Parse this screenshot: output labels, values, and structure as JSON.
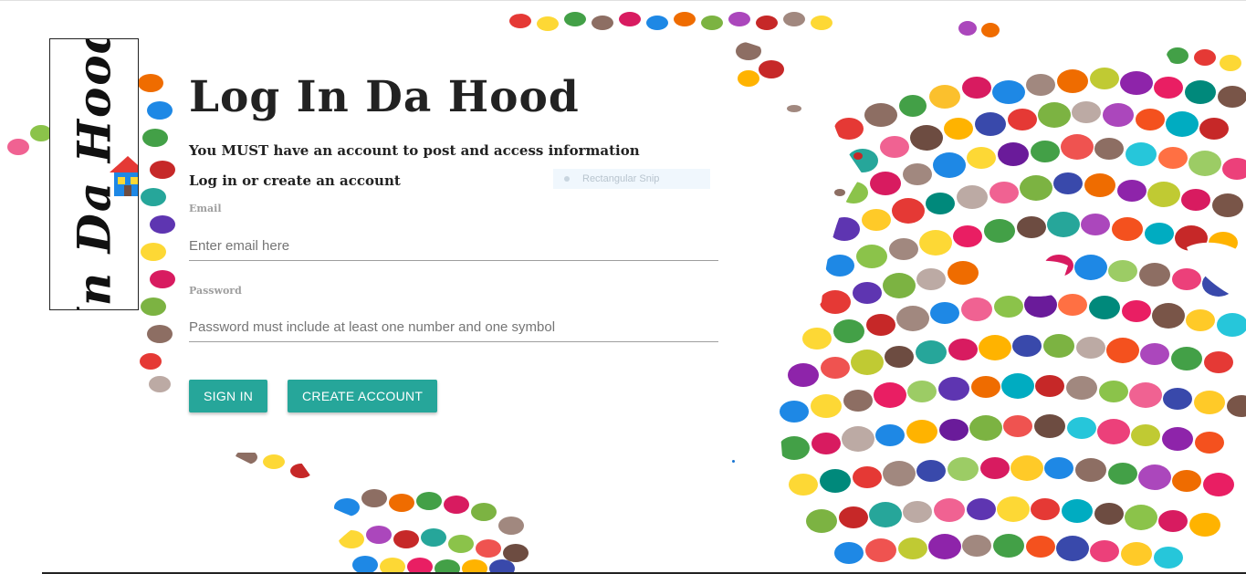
{
  "logo": {
    "text": "In Da Hood",
    "icon": "house-icon"
  },
  "form": {
    "title": "Log In Da Hood",
    "subtitle": "You MUST have an account to post and access information",
    "subtitle2": "Log in or create an account",
    "email_label": "Email",
    "email_placeholder": "Enter email here",
    "email_value": "",
    "password_label": "Password",
    "password_placeholder": "Password must include at least one number and one symbol",
    "password_value": "",
    "signin_label": "SIGN IN",
    "create_label": "CREATE ACCOUNT"
  },
  "overlay": {
    "snip_label": "Rectangular Snip"
  },
  "colors": {
    "button": "#26a69a",
    "title": "#222222",
    "label": "#9e9e9e"
  }
}
